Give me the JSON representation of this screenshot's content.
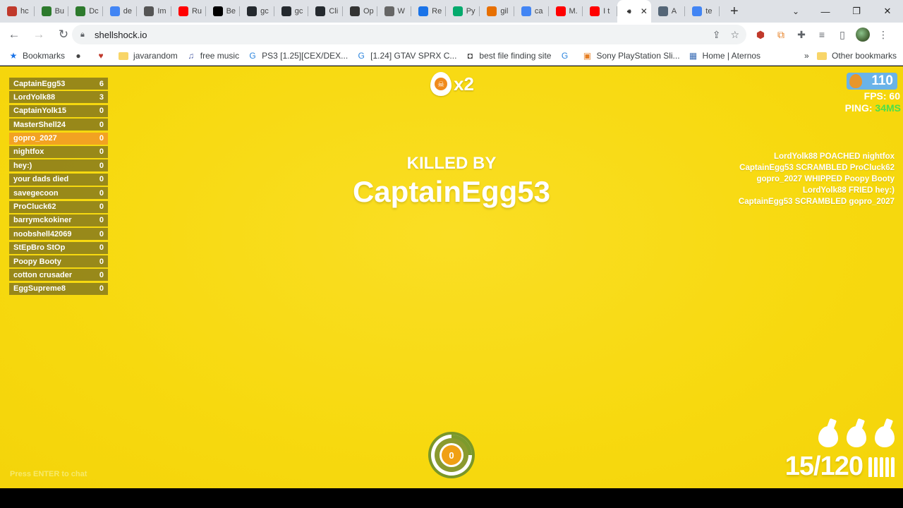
{
  "browser": {
    "tabs": [
      {
        "label": "hc",
        "icon": "flame-icon",
        "color": "#c0392b"
      },
      {
        "label": "Bu",
        "icon": "bugsnag-icon",
        "color": "#2d7a2d"
      },
      {
        "label": "Dc",
        "icon": "bugsnag-icon",
        "color": "#2d7a2d"
      },
      {
        "label": "de",
        "icon": "google-icon",
        "color": "#4285f4"
      },
      {
        "label": "Im",
        "icon": "chart-icon",
        "color": "#555555"
      },
      {
        "label": "Ru",
        "icon": "youtube-icon",
        "color": "#ff0000"
      },
      {
        "label": "Be",
        "icon": "medium-icon",
        "color": "#000000"
      },
      {
        "label": "gc",
        "icon": "github-icon",
        "color": "#24292e"
      },
      {
        "label": "gc",
        "icon": "github-icon",
        "color": "#24292e"
      },
      {
        "label": "Cli",
        "icon": "github-icon",
        "color": "#24292e"
      },
      {
        "label": "Op",
        "icon": "openai-icon",
        "color": "#333333"
      },
      {
        "label": "W",
        "icon": "globe-icon",
        "color": "#666666"
      },
      {
        "label": "Re",
        "icon": "record-icon",
        "color": "#1a73e8"
      },
      {
        "label": "Py",
        "icon": "w3-icon",
        "color": "#04aa6d"
      },
      {
        "label": "gil",
        "icon": "java-icon",
        "color": "#e76f00"
      },
      {
        "label": "ca",
        "icon": "google-icon",
        "color": "#4285f4"
      },
      {
        "label": "M.",
        "icon": "youtube-icon",
        "color": "#ff0000"
      },
      {
        "label": "I t",
        "icon": "youtube-icon",
        "color": "#ff0000"
      },
      {
        "label": "",
        "icon": "audio-icon",
        "color": "#333333",
        "active": true
      },
      {
        "label": "A",
        "icon": "avatar-icon",
        "color": "#556677"
      },
      {
        "label": "te",
        "icon": "google-icon",
        "color": "#4285f4"
      }
    ],
    "new_tab": "+",
    "url": "shellshock.io",
    "bookmarks": [
      {
        "label": "Bookmarks",
        "icon": "star-icon"
      },
      {
        "label": "",
        "icon": "globe-icon"
      },
      {
        "label": "",
        "icon": "heart-icon"
      },
      {
        "label": "javarandom",
        "icon": "folder-icon"
      },
      {
        "label": "free music",
        "icon": "headphones-icon"
      },
      {
        "label": "PS3 [1.25][CEX/DEX...",
        "icon": "site-icon"
      },
      {
        "label": "[1.24] GTAV SPRX C...",
        "icon": "site-icon"
      },
      {
        "label": "best file finding site",
        "icon": "camera-icon"
      },
      {
        "label": "",
        "icon": "site-icon"
      },
      {
        "label": "Sony PlayStation Sli...",
        "icon": "bag-icon"
      },
      {
        "label": "Home | Aternos",
        "icon": "aternos-icon"
      }
    ],
    "other_bookmarks": "Other bookmarks"
  },
  "game": {
    "scoreboard": [
      {
        "name": "CaptainEgg53",
        "score": "6"
      },
      {
        "name": "LordYolk88",
        "score": "3"
      },
      {
        "name": "CaptainYolk15",
        "score": "0"
      },
      {
        "name": "MasterShell24",
        "score": "0"
      },
      {
        "name": "gopro_2027",
        "score": "0",
        "me": true
      },
      {
        "name": "nightfox",
        "score": "0"
      },
      {
        "name": "hey:)",
        "score": "0"
      },
      {
        "name": "your dads died",
        "score": "0"
      },
      {
        "name": "savegecoon",
        "score": "0"
      },
      {
        "name": "ProCluck62",
        "score": "0"
      },
      {
        "name": "barrymckokiner",
        "score": "0"
      },
      {
        "name": "noobshell42069",
        "score": "0"
      },
      {
        "name": "StEpBro StOp",
        "score": "0"
      },
      {
        "name": "Poopy Booty",
        "score": "0"
      },
      {
        "name": "cotton crusader",
        "score": "0"
      },
      {
        "name": "EggSupreme8",
        "score": "0"
      }
    ],
    "streak": "x2",
    "killed_by_label": "KILLED BY",
    "killer_name": "CaptainEgg53",
    "eggs": "110",
    "fps_label": "FPS: 60",
    "ping_label": "PING:",
    "ping_value": "34MS",
    "ping_color": "#4be04b",
    "killfeed": [
      "LordYolk88 POACHED nightfox",
      "CaptainEgg53 SCRAMBLED ProCluck62",
      "gopro_2027 WHIPPED Poopy Booty",
      "LordYolk88 FRIED hey:)",
      "CaptainEgg53 SCRAMBLED gopro_2027"
    ],
    "grenade_meter_value": "0",
    "grenade_count": 3,
    "ammo": "15/120",
    "chat_hint": "Press ENTER to chat",
    "colors": {
      "background": "#f7d90f",
      "scoreboard_row": "#786e1e",
      "my_row": "#f2a222",
      "currency_badge": "#6ab3e8"
    }
  }
}
